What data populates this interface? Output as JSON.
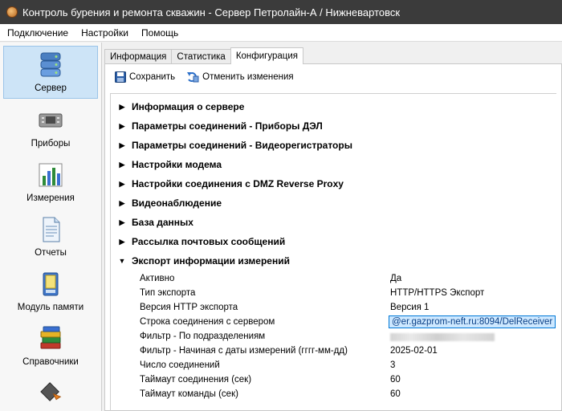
{
  "window": {
    "title": "Контроль бурения и ремонта скважин - Сервер Петролайн-А / Нижневартовск"
  },
  "menu": [
    "Подключение",
    "Настройки",
    "Помощь"
  ],
  "sidebar": {
    "items": [
      {
        "label": "Сервер",
        "icon": "server-icon",
        "active": true
      },
      {
        "label": "Приборы",
        "icon": "device-icon"
      },
      {
        "label": "Измерения",
        "icon": "chart-icon"
      },
      {
        "label": "Отчеты",
        "icon": "report-icon"
      },
      {
        "label": "Модуль памяти",
        "icon": "memory-module-icon"
      },
      {
        "label": "Справочники",
        "icon": "books-icon"
      },
      {
        "label": "",
        "icon": "chip-icon"
      }
    ]
  },
  "tabs": [
    {
      "label": "Информация"
    },
    {
      "label": "Статистика"
    },
    {
      "label": "Конфигурация",
      "active": true
    }
  ],
  "toolbar": {
    "save_label": "Сохранить",
    "revert_label": "Отменить изменения"
  },
  "sections": [
    {
      "label": "Информация о сервере",
      "expanded": false
    },
    {
      "label": "Параметры соединений - Приборы ДЭЛ",
      "expanded": false
    },
    {
      "label": "Параметры соединений - Видеорегистраторы",
      "expanded": false
    },
    {
      "label": "Настройки модема",
      "expanded": false
    },
    {
      "label": "Настройки соединения с DMZ Reverse Proxy",
      "expanded": false
    },
    {
      "label": "Видеонаблюдение",
      "expanded": false
    },
    {
      "label": "База данных",
      "expanded": false
    },
    {
      "label": "Рассылка почтовых сообщений",
      "expanded": false
    },
    {
      "label": "Экспорт информации измерений",
      "expanded": true
    }
  ],
  "export_props": [
    {
      "key": "Активно",
      "value": "Да"
    },
    {
      "key": "Тип экспорта",
      "value": "HTTP/HTTPS Экспорт"
    },
    {
      "key": "Версия HTTP экспорта",
      "value": "Версия 1"
    },
    {
      "key": "Строка соединения с сервером",
      "value": "@er.gazprom-neft.ru:8094/DelReceiver",
      "selected": true
    },
    {
      "key": "Фильтр - По подразделениям",
      "value": "",
      "redacted": true
    },
    {
      "key": "Фильтр - Начиная с даты измерений (гггг-мм-дд)",
      "value": "2025-02-01"
    },
    {
      "key": "Число соединений",
      "value": "3"
    },
    {
      "key": "Таймаут соединения (сек)",
      "value": "60"
    },
    {
      "key": "Таймаут команды (сек)",
      "value": "60"
    }
  ],
  "colors": {
    "titlebar": "#3b3b3b",
    "sidebar_active": "#cde4f7",
    "selection_border": "#0078d7"
  }
}
